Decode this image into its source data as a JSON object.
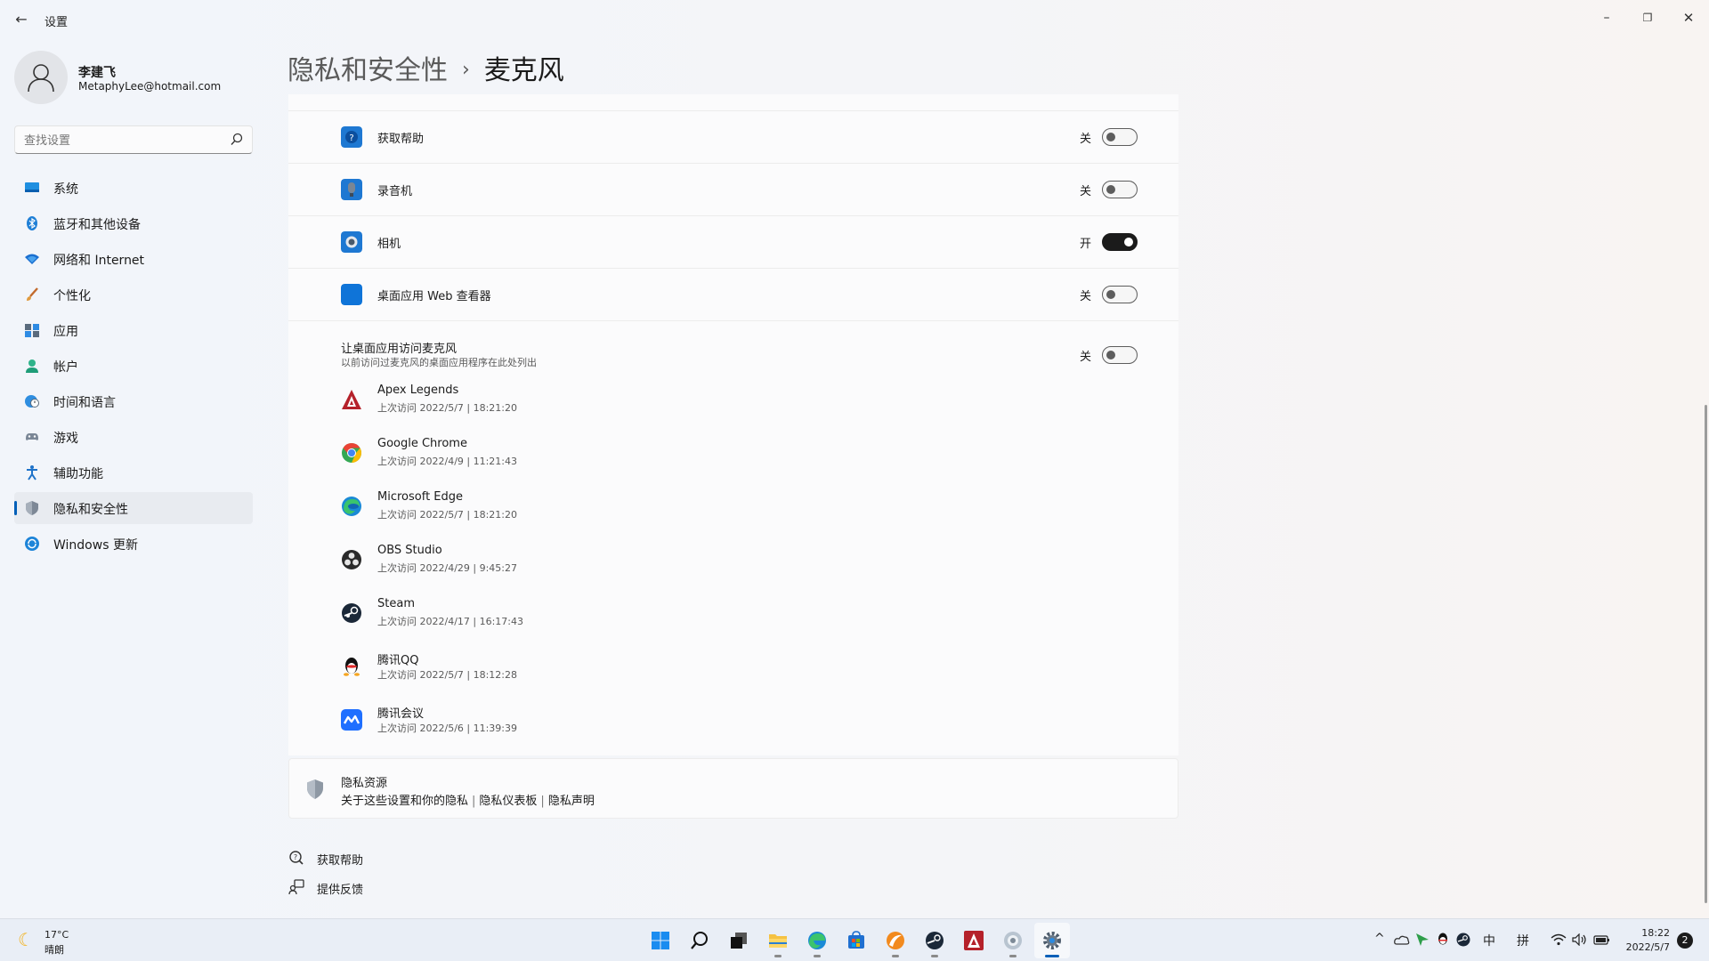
{
  "window": {
    "title": "设置",
    "controls": {
      "minimize": "–",
      "maximize": "❐",
      "close": "✕"
    }
  },
  "profile": {
    "name": "李建飞",
    "email": "MetaphyLee@hotmail.com"
  },
  "search": {
    "placeholder": "查找设置",
    "value": ""
  },
  "nav": [
    {
      "label": "系统",
      "icon": "system-icon"
    },
    {
      "label": "蓝牙和其他设备",
      "icon": "bluetooth-icon"
    },
    {
      "label": "网络和 Internet",
      "icon": "wifi-icon"
    },
    {
      "label": "个性化",
      "icon": "brush-icon"
    },
    {
      "label": "应用",
      "icon": "apps-icon"
    },
    {
      "label": "帐户",
      "icon": "account-icon"
    },
    {
      "label": "时间和语言",
      "icon": "globe-clock-icon"
    },
    {
      "label": "游戏",
      "icon": "gamepad-icon"
    },
    {
      "label": "辅助功能",
      "icon": "accessibility-icon"
    },
    {
      "label": "隐私和安全性",
      "icon": "shield-icon",
      "active": true
    },
    {
      "label": "Windows 更新",
      "icon": "update-icon"
    }
  ],
  "breadcrumb": {
    "parent": "隐私和安全性",
    "separator": "›",
    "current": "麦克风"
  },
  "app_rows": [
    {
      "label": "获取帮助",
      "state": "关",
      "on": false,
      "icon": "get-help-icon"
    },
    {
      "label": "录音机",
      "state": "关",
      "on": false,
      "icon": "recorder-icon"
    },
    {
      "label": "相机",
      "state": "开",
      "on": true,
      "icon": "camera-icon"
    },
    {
      "label": "桌面应用 Web 查看器",
      "state": "关",
      "on": false,
      "icon": "web-viewer-icon"
    }
  ],
  "desktop_apps": {
    "title": "让桌面应用访问麦克风",
    "subtitle": "以前访问过麦克风的桌面应用程序在此处列出",
    "state": "关",
    "on": false,
    "apps": [
      {
        "name": "Apex Legends",
        "last_access": "上次访问 2022/5/7  |  18:21:20",
        "icon": "apex-icon"
      },
      {
        "name": "Google Chrome",
        "last_access": "上次访问 2022/4/9  |  11:21:43",
        "icon": "chrome-icon"
      },
      {
        "name": "Microsoft Edge",
        "last_access": "上次访问 2022/5/7  |  18:21:20",
        "icon": "edge-icon"
      },
      {
        "name": "OBS Studio",
        "last_access": "上次访问 2022/4/29  |  9:45:27",
        "icon": "obs-icon"
      },
      {
        "name": "Steam",
        "last_access": "上次访问 2022/4/17  |  16:17:43",
        "icon": "steam-icon"
      },
      {
        "name": "腾讯QQ",
        "last_access": "上次访问 2022/5/7  |  18:12:28",
        "icon": "qq-icon"
      },
      {
        "name": "腾讯会议",
        "last_access": "上次访问 2022/5/6  |  11:39:39",
        "icon": "tencent-meeting-icon"
      }
    ]
  },
  "privacy_resources": {
    "title": "隐私资源",
    "links": [
      "关于这些设置和你的隐私",
      "隐私仪表板",
      "隐私声明"
    ],
    "separator": "|"
  },
  "footer": {
    "help": "获取帮助",
    "feedback": "提供反馈"
  },
  "taskbar": {
    "weather": {
      "temp": "17°C",
      "condition": "晴朗"
    },
    "apps": [
      "start-icon",
      "search-icon",
      "task-view-icon",
      "file-explorer-icon",
      "edge-icon",
      "store-icon",
      "app-orange-icon",
      "steam-icon",
      "apex-icon",
      "app-globe-icon",
      "settings-icon"
    ],
    "tray": {
      "ime_lang": "中",
      "ime_mode": "拼"
    },
    "clock": {
      "time": "18:22",
      "date": "2022/5/7"
    },
    "notifications": "2"
  },
  "colors": {
    "accent": "#005fb8",
    "toggle_on": "#1b1b1b",
    "card": "#fbfbfc"
  }
}
